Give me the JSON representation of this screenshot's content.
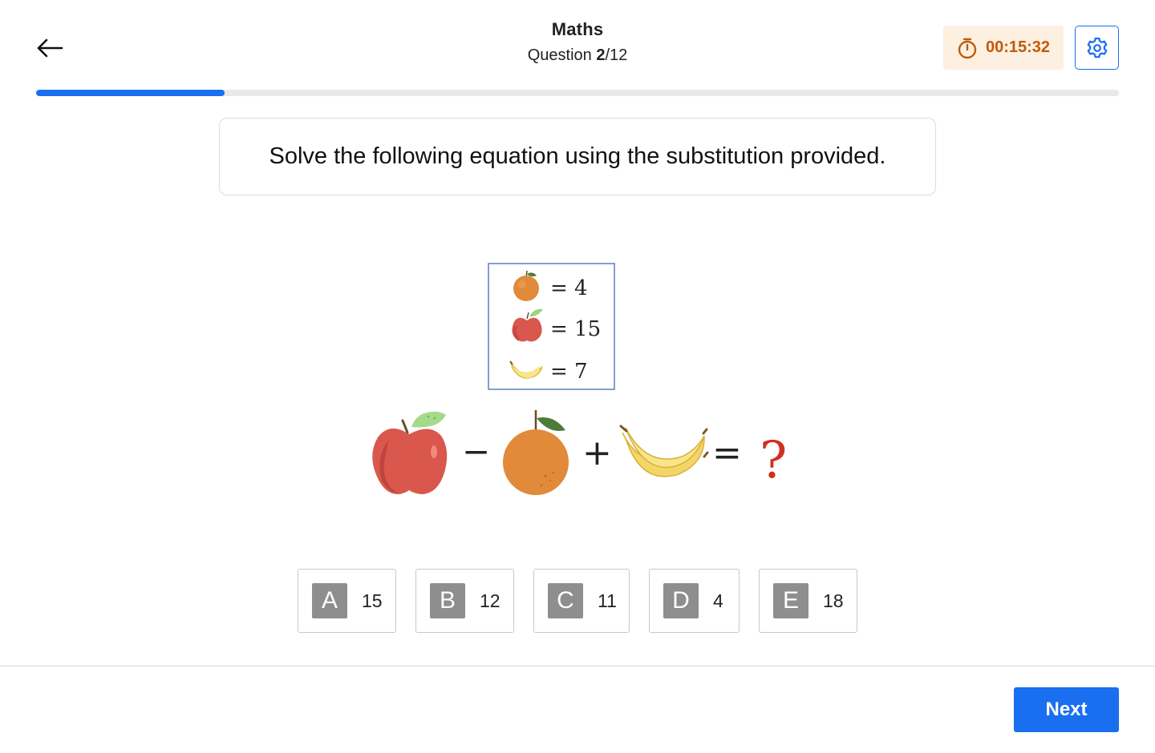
{
  "header": {
    "subject": "Maths",
    "question_label": "Question ",
    "question_current": "2",
    "question_total": "/12"
  },
  "timer": {
    "value": "00:15:32",
    "icon": "stopwatch-icon"
  },
  "settings": {
    "icon": "gear-icon"
  },
  "back": {
    "icon": "arrow-left-icon"
  },
  "progress": {
    "fraction": 0.174,
    "color": "#1a6ef0"
  },
  "question": {
    "text": "Solve the following equation using the substitution provided."
  },
  "puzzle": {
    "legend": [
      {
        "fruit": "orange",
        "value": "= 4"
      },
      {
        "fruit": "apple",
        "value": "= 15"
      },
      {
        "fruit": "banana",
        "value": "= 7"
      }
    ],
    "equation": {
      "minus": "−",
      "plus": "+",
      "equals": "=",
      "unknown": "?"
    }
  },
  "options": [
    {
      "letter": "A",
      "value": "15"
    },
    {
      "letter": "B",
      "value": "12"
    },
    {
      "letter": "C",
      "value": "11"
    },
    {
      "letter": "D",
      "value": "4"
    },
    {
      "letter": "E",
      "value": "18"
    }
  ],
  "footer": {
    "next_label": "Next"
  },
  "colors": {
    "accent": "#1a6ef0",
    "timer_bg": "#fdf0e1",
    "timer_text": "#c05a0a",
    "unknown": "#d0301e"
  }
}
